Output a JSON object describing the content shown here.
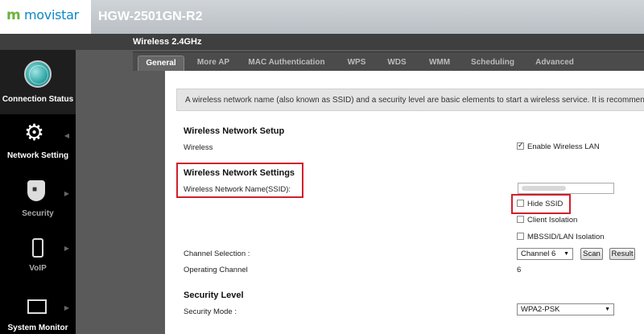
{
  "brand": {
    "logo_mark": "m",
    "logo_text": "movistar"
  },
  "header": {
    "model": "HGW-2501GN-R2",
    "section_title": "Wireless 2.4GHz"
  },
  "sidebar": {
    "items": [
      {
        "label": "Connection Status"
      },
      {
        "label": "Network Setting"
      },
      {
        "label": "Security"
      },
      {
        "label": "VoIP"
      },
      {
        "label": "System Monitor"
      }
    ]
  },
  "tabs": [
    {
      "label": "General",
      "active": true
    },
    {
      "label": "More AP"
    },
    {
      "label": "MAC Authentication"
    },
    {
      "label": "WPS"
    },
    {
      "label": "WDS"
    },
    {
      "label": "WMM"
    },
    {
      "label": "Scheduling"
    },
    {
      "label": "Advanced"
    }
  ],
  "info_text": "A wireless network name (also known as SSID) and a security level are basic elements to start a wireless service. It is recommended t",
  "setup": {
    "title": "Wireless Network Setup",
    "wireless_label": "Wireless",
    "enable_label": "Enable Wireless LAN",
    "enable_checked": true
  },
  "settings": {
    "title": "Wireless Network Settings",
    "ssid_label": "Wireless Network Name(SSID):",
    "hide_ssid_label": "Hide SSID",
    "client_isolation_label": "Client Isolation",
    "mbssid_label": "MBSSID/LAN Isolation",
    "channel_label": "Channel Selection :",
    "channel_value": "Channel 6",
    "scan_label": "Scan",
    "result_label": "Result",
    "operating_label": "Operating Channel",
    "operating_value": "6"
  },
  "security": {
    "title": "Security Level",
    "mode_label": "Security Mode :",
    "mode_value": "WPA2-PSK"
  },
  "colors": {
    "highlight": "#d0202c",
    "brand_green": "#6bb33c",
    "brand_blue": "#0d88c8"
  }
}
